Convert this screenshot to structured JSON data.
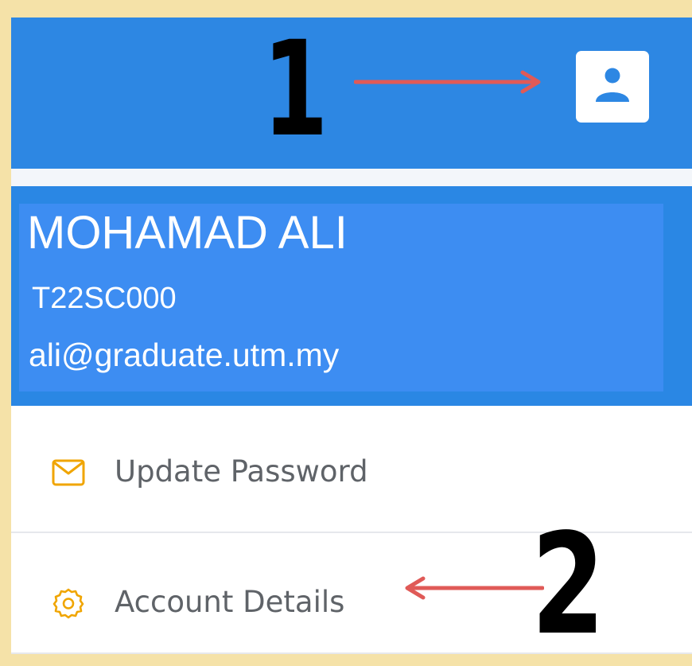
{
  "annotations": {
    "marker_1": "1",
    "marker_2": "2"
  },
  "header": {
    "user_icon": "user-profile-icon"
  },
  "profile": {
    "name": "MOHAMAD ALI",
    "id": "T22SC000",
    "email": "ali@graduate.utm.my"
  },
  "menu": {
    "items": [
      {
        "label": "Update Password",
        "icon": "envelope-icon"
      },
      {
        "label": "Account Details",
        "icon": "gear-icon"
      }
    ]
  },
  "colors": {
    "background": "#f5e2a8",
    "header_blue": "#2d87e3",
    "highlight_blue": "#3d8df2",
    "icon_orange": "#f0a500",
    "arrow_red": "#e05a57",
    "label_gray": "#5f6368"
  }
}
